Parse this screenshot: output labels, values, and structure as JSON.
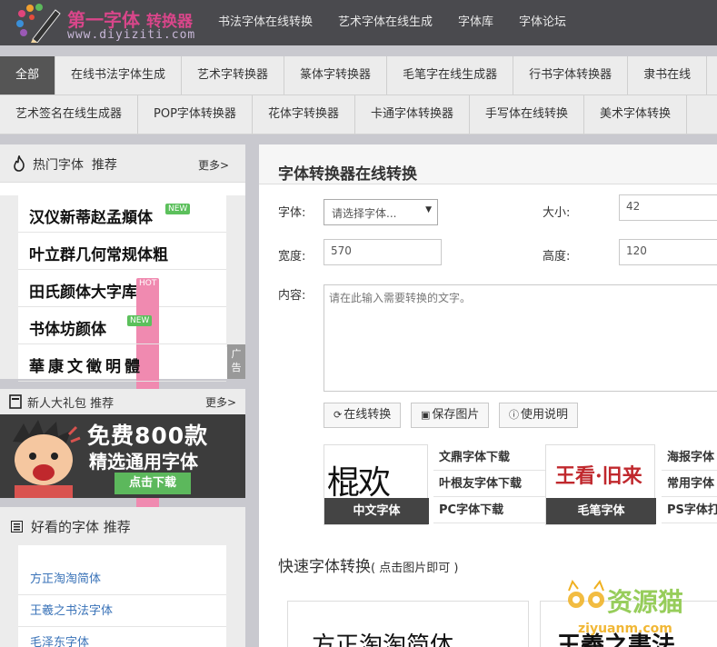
{
  "header": {
    "logo_cn": "第一字体",
    "logo_cn_sub": "转换器",
    "logo_en": "www.diyiziti.com",
    "nav": [
      "书法字体在线转换",
      "艺术字体在线生成",
      "字体库",
      "字体论坛"
    ]
  },
  "categories_row1": [
    "全部",
    "在线书法字体生成",
    "艺术字转换器",
    "篆体字转换器",
    "毛笔字在线生成器",
    "行书字体转换器",
    "隶书在线"
  ],
  "categories_row2": [
    "艺术签名在线生成器",
    "POP字体转换器",
    "花体字转换器",
    "卡通字体转换器",
    "手写体在线转换",
    "美术字体转换"
  ],
  "hot": {
    "title": "热门字体",
    "suffix": "推荐",
    "more": "更多>",
    "items": [
      {
        "name": "汉仪新蒂赵孟頫体",
        "badge": "NEW"
      },
      {
        "name": "叶立群几何常规体粗",
        "badge": ""
      },
      {
        "name": "田氏颜体大字库",
        "badge": "HOT"
      },
      {
        "name": "书体坊颜体",
        "badge": "NEW"
      },
      {
        "name": "華康文徵明體",
        "badge": ""
      }
    ],
    "ad_label": "广告"
  },
  "gift": {
    "title": "新人大礼包",
    "suffix": "推荐",
    "more": "更多>",
    "line1": "免费800款",
    "line2": "精选通用字体",
    "button": "点击下载"
  },
  "nice": {
    "title": "好看的字体",
    "suffix": "推荐",
    "items": [
      "方正淘淘简体",
      "王羲之书法字体",
      "毛泽东字体"
    ]
  },
  "converter": {
    "title": "字体转换器在线转换",
    "font_label": "字体:",
    "font_select": "请选择字体...",
    "size_label": "大小:",
    "size_value": "42",
    "width_label": "宽度:",
    "width_value": "570",
    "height_label": "高度:",
    "height_value": "120",
    "content_label": "内容:",
    "content_placeholder": "请在此输入需要转换的文字。",
    "btn_convert": "在线转换",
    "btn_save": "保存图片",
    "btn_help": "使用说明"
  },
  "banner": {
    "img1_text": "棍欢",
    "img1_caption": "中文字体",
    "links1": [
      "文鼎字体下载",
      "叶根友字体下载",
      "PC字体下载"
    ],
    "img2_text": "王看·旧来",
    "img2_caption": "毛笔字体",
    "links2": [
      "海报字体",
      "常用字体",
      "PS字体打"
    ]
  },
  "quick": {
    "title": "快速字体转换",
    "hint": "( 点击图片即可 )",
    "card1": "方正淘淘简体",
    "card2": "王羲之書法"
  },
  "watermark": {
    "cn": "资源猫",
    "en": "ziyuanm.com"
  }
}
